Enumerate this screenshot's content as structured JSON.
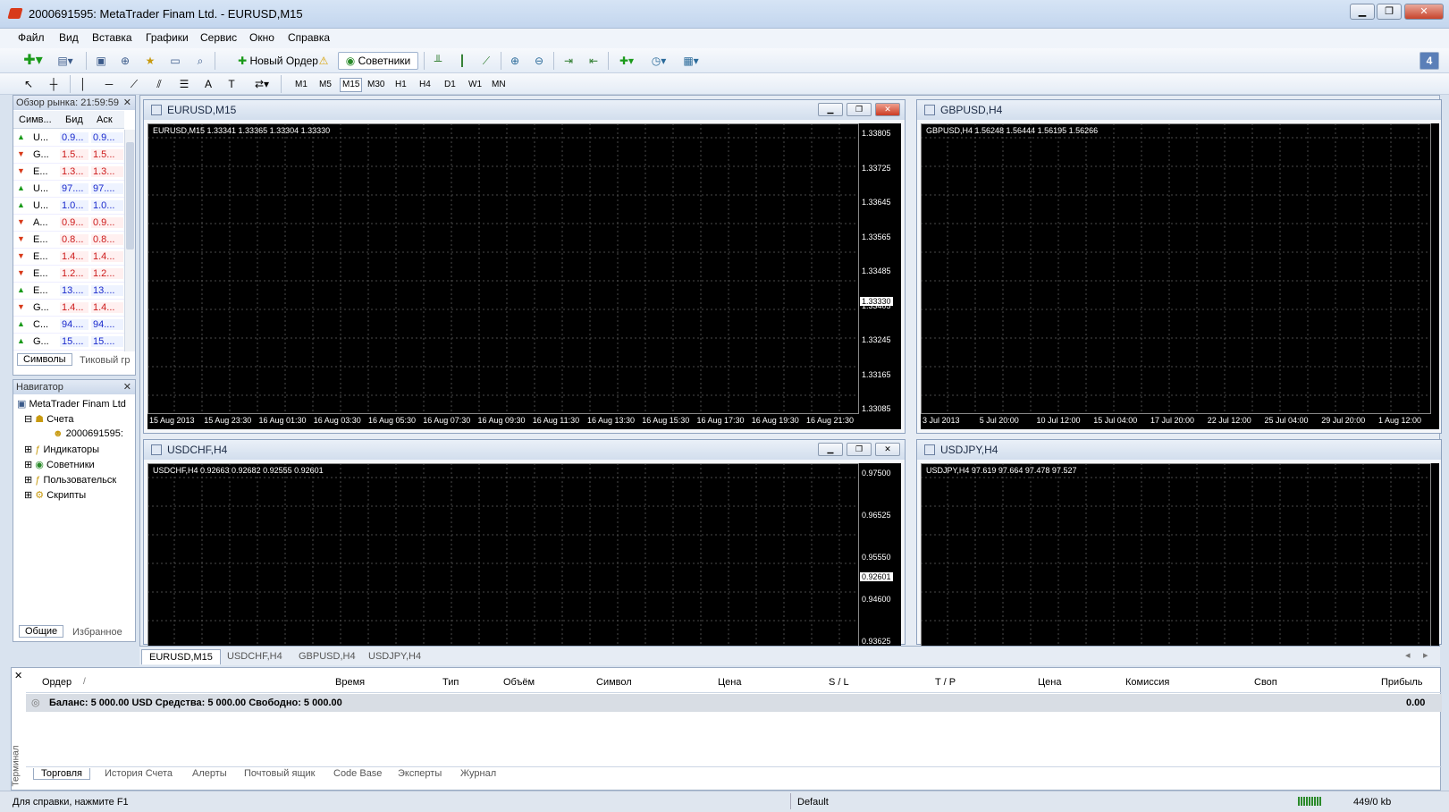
{
  "window": {
    "title": "2000691595: MetaTrader Finam Ltd. - EURUSD,M15"
  },
  "menu": [
    "Файл",
    "Вид",
    "Вставка",
    "Графики",
    "Сервис",
    "Окно",
    "Справка"
  ],
  "toolbar": {
    "new_order": "Новый Ордер",
    "experts": "Советники",
    "badge": "4"
  },
  "timeframes": [
    "M1",
    "M5",
    "M15",
    "M30",
    "H1",
    "H4",
    "D1",
    "W1",
    "MN"
  ],
  "market_watch": {
    "title": "Обзор рынка: 21:59:59",
    "headers": [
      "Симв...",
      "Бид",
      "Аск"
    ],
    "rows": [
      {
        "dir": "up",
        "sym": "U...",
        "bid": "0.9...",
        "ask": "0.9...",
        "color": "blue"
      },
      {
        "dir": "down",
        "sym": "G...",
        "bid": "1.5...",
        "ask": "1.5...",
        "color": "red"
      },
      {
        "dir": "down",
        "sym": "E...",
        "bid": "1.3...",
        "ask": "1.3...",
        "color": "red"
      },
      {
        "dir": "up",
        "sym": "U...",
        "bid": "97....",
        "ask": "97....",
        "color": "blue"
      },
      {
        "dir": "up",
        "sym": "U...",
        "bid": "1.0...",
        "ask": "1.0...",
        "color": "blue"
      },
      {
        "dir": "down",
        "sym": "A...",
        "bid": "0.9...",
        "ask": "0.9...",
        "color": "red"
      },
      {
        "dir": "down",
        "sym": "E...",
        "bid": "0.8...",
        "ask": "0.8...",
        "color": "red"
      },
      {
        "dir": "down",
        "sym": "E...",
        "bid": "1.4...",
        "ask": "1.4...",
        "color": "red"
      },
      {
        "dir": "down",
        "sym": "E...",
        "bid": "1.2...",
        "ask": "1.2...",
        "color": "red"
      },
      {
        "dir": "up",
        "sym": "E...",
        "bid": "13....",
        "ask": "13....",
        "color": "blue"
      },
      {
        "dir": "down",
        "sym": "G...",
        "bid": "1.4...",
        "ask": "1.4...",
        "color": "red"
      },
      {
        "dir": "up",
        "sym": "C...",
        "bid": "94....",
        "ask": "94....",
        "color": "blue"
      },
      {
        "dir": "up",
        "sym": "G...",
        "bid": "15....",
        "ask": "15....",
        "color": "blue"
      }
    ],
    "tabs": [
      "Символы",
      "Тиковый гр"
    ]
  },
  "navigator": {
    "title": "Навигатор",
    "items": [
      "MetaTrader Finam Ltd",
      "Счета",
      "2000691595:",
      "Индикаторы",
      "Советники",
      "Пользовательск",
      "Скрипты"
    ],
    "tabs": [
      "Общие",
      "Избранное"
    ]
  },
  "charts": [
    {
      "id": "eurusd",
      "title": "EURUSD,M15",
      "info": "EURUSD,M15  1.33341 1.33365 1.33304 1.33330",
      "prices": [
        "1.33805",
        "1.33725",
        "1.33645",
        "1.33565",
        "1.33485",
        "1.33405",
        "1.33245",
        "1.33165",
        "1.33085"
      ],
      "current": "1.33330",
      "times": [
        "15 Aug 2013",
        "15 Aug 23:30",
        "16 Aug 01:30",
        "16 Aug 03:30",
        "16 Aug 05:30",
        "16 Aug 07:30",
        "16 Aug 09:30",
        "16 Aug 11:30",
        "16 Aug 13:30",
        "16 Aug 15:30",
        "16 Aug 17:30",
        "16 Aug 19:30",
        "16 Aug 21:30"
      ]
    },
    {
      "id": "gbpusd",
      "title": "GBPUSD,H4",
      "info": "GBPUSD,H4  1.56248 1.56444 1.56195 1.56266",
      "prices": [],
      "current": "",
      "times": [
        "3 Jul 2013",
        "5 Jul 20:00",
        "10 Jul 12:00",
        "15 Jul 04:00",
        "17 Jul 20:00",
        "22 Jul 12:00",
        "25 Jul 04:00",
        "29 Jul 20:00",
        "1 Aug 12:00"
      ]
    },
    {
      "id": "usdchf",
      "title": "USDCHF,H4",
      "info": "USDCHF,H4  0.92663 0.92682 0.92555 0.92601",
      "prices": [
        "0.97500",
        "0.96525",
        "0.95550",
        "0.94600",
        "0.93625"
      ],
      "current": "0.92601",
      "times": []
    },
    {
      "id": "usdjpy",
      "title": "USDJPY,H4",
      "info": "USDJPY,H4  97.619 97.664 97.478 97.527",
      "prices": [],
      "current": "",
      "times": []
    }
  ],
  "chart_tabs": [
    "EURUSD,M15",
    "USDCHF,H4",
    "GBPUSD,H4",
    "USDJPY,H4"
  ],
  "terminal": {
    "side_label": "Терминал",
    "headers": [
      "Ордер",
      "Время",
      "Тип",
      "Объём",
      "Символ",
      "Цена",
      "S / L",
      "T / P",
      "Цена",
      "Комиссия",
      "Своп",
      "Прибыль"
    ],
    "balance_row": "Баланс: 5 000.00 USD  Средства: 5 000.00  Свободно: 5 000.00",
    "balance_profit": "0.00",
    "tabs": [
      "Торговля",
      "История Счета",
      "Алерты",
      "Почтовый ящик",
      "Code Base",
      "Эксперты",
      "Журнал"
    ]
  },
  "status": {
    "help": "Для справки, нажмите F1",
    "profile": "Default",
    "traffic": "449/0 kb"
  },
  "colors": {
    "bull": "#00c000",
    "ma": "#c01010",
    "grid": "#4a4a4a"
  }
}
